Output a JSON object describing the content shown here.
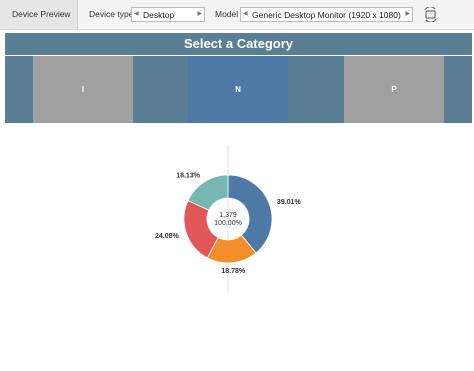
{
  "toolbar": {
    "preview_label": "Device Preview",
    "device_type_label": "Device type",
    "device_type_value": "Desktop",
    "model_label": "Model",
    "model_value": "Generic Desktop Monitor (1920 x 1080)"
  },
  "dashboard": {
    "title": "Select a Category",
    "categories": [
      {
        "label": "I",
        "selected": false
      },
      {
        "label": "N",
        "selected": true
      },
      {
        "label": "P",
        "selected": false
      }
    ],
    "colors": {
      "band": "#5a7f94",
      "tile": "#a0a0a0",
      "tile_selected": "#4e79a7"
    }
  },
  "chart_data": {
    "type": "pie",
    "donut": true,
    "center_total": "1,379",
    "center_pct": "100.00%",
    "slices": [
      {
        "value": 39.01,
        "label": "39.01%",
        "color": "#4e79a7"
      },
      {
        "value": 18.78,
        "label": "18.78%",
        "color": "#f28e2b"
      },
      {
        "value": 24.08,
        "label": "24.08%",
        "color": "#e15759"
      },
      {
        "value": 18.13,
        "label": "18.13%",
        "color": "#76b7b2"
      }
    ]
  }
}
